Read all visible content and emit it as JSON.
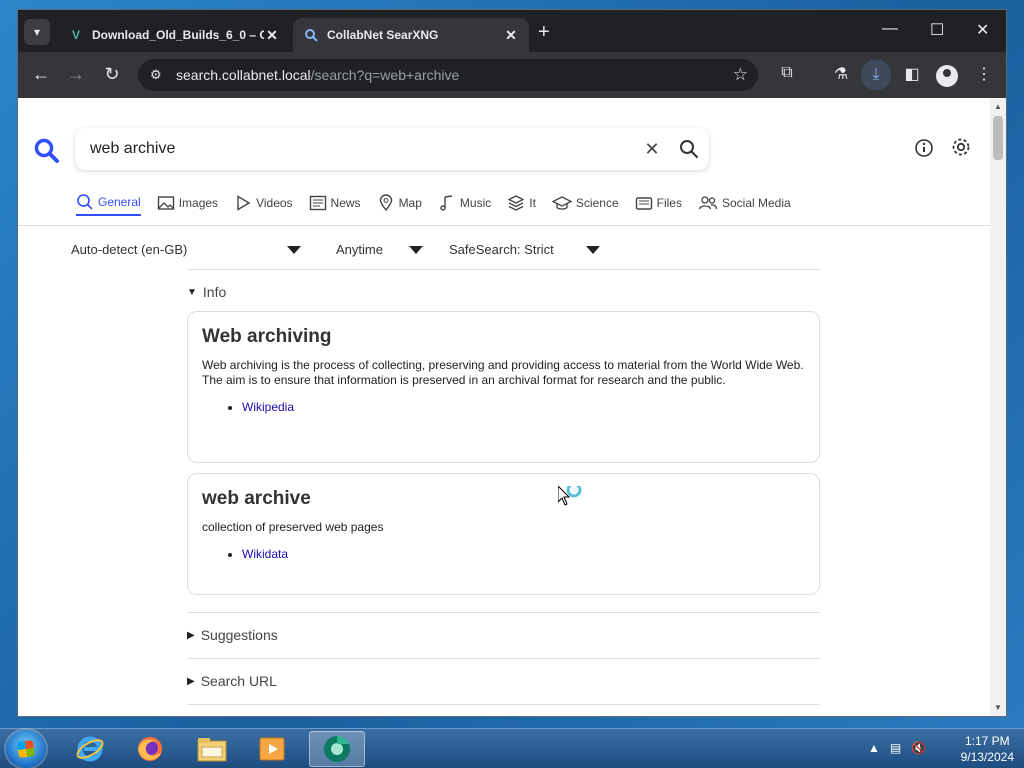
{
  "browser": {
    "tabs": [
      {
        "title": "Download_Old_Builds_6_0 – O",
        "active": false
      },
      {
        "title": "CollabNet SearXNG",
        "active": true
      }
    ],
    "address": {
      "host": "search.collabnet.local",
      "path": "/search?q=web+archive"
    }
  },
  "search": {
    "query": "web archive",
    "categories": [
      {
        "label": "General",
        "icon": "search-icon",
        "active": true
      },
      {
        "label": "Images",
        "icon": "image-icon"
      },
      {
        "label": "Videos",
        "icon": "play-icon"
      },
      {
        "label": "News",
        "icon": "newspaper-icon"
      },
      {
        "label": "Map",
        "icon": "map-pin-icon"
      },
      {
        "label": "Music",
        "icon": "music-note-icon"
      },
      {
        "label": "It",
        "icon": "layers-icon"
      },
      {
        "label": "Science",
        "icon": "graduation-cap-icon"
      },
      {
        "label": "Files",
        "icon": "file-tray-icon"
      },
      {
        "label": "Social Media",
        "icon": "people-icon"
      }
    ],
    "filters": {
      "language": "Auto-detect (en-GB)",
      "time": "Anytime",
      "safesearch": "SafeSearch: Strict"
    }
  },
  "results": {
    "info_label": "Info",
    "cards": [
      {
        "title": "Web archiving",
        "text": "Web archiving is the process of collecting, preserving and providing access to material from the World Wide Web. The aim is to ensure that information is preserved in an archival format for research and the public.",
        "link": "Wikipedia"
      },
      {
        "title": "web archive",
        "text": "collection of preserved web pages",
        "link": "Wikidata"
      }
    ],
    "suggestions_label": "Suggestions",
    "search_url_label": "Search URL"
  },
  "taskbar": {
    "time": "1:17 PM",
    "date": "9/13/2024"
  }
}
